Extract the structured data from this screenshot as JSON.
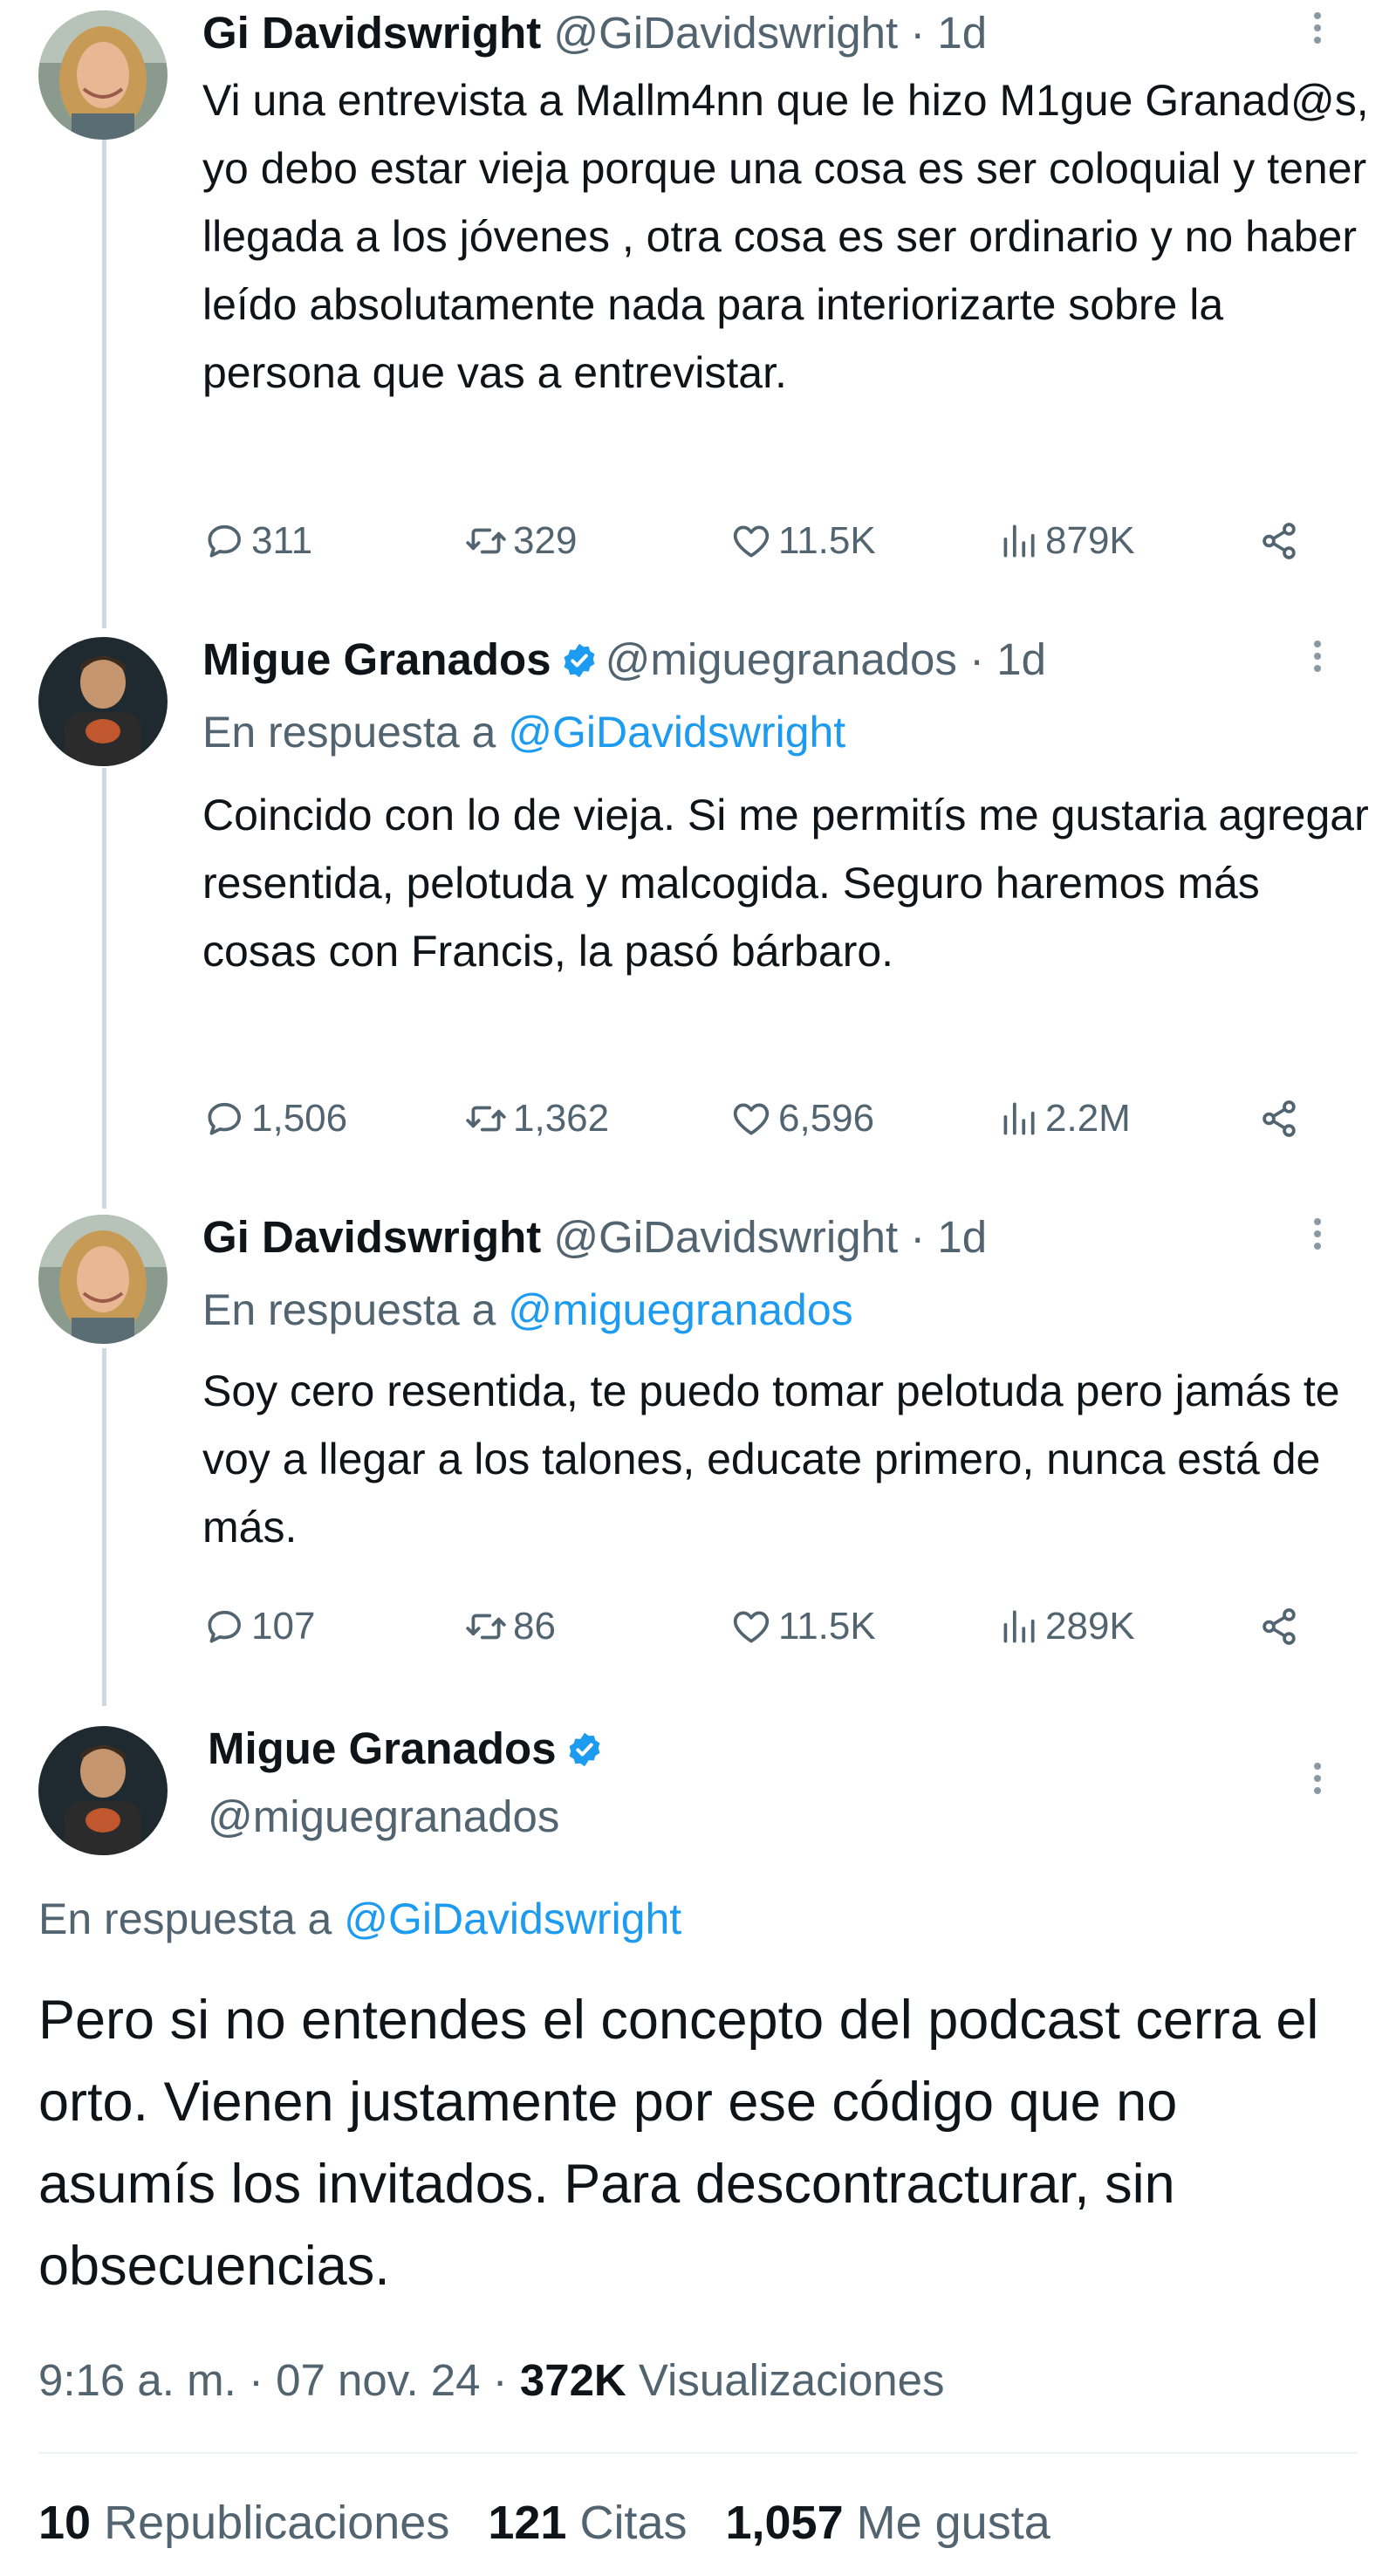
{
  "tweets": [
    {
      "name": "Gi Davidswright",
      "handle": "@GiDavidswright · 1d",
      "reply_prefix": "",
      "reply_handle": "",
      "text": "Vi una entrevista a Mallm4nn que le hizo M1gue Granad@s, yo debo estar vieja porque una cosa es ser coloquial y tener llegada a los jóvenes , otra cosa es ser ordinario y no haber leído absolutamente nada para interiorizarte sobre la persona que vas a entrevistar.",
      "replies": "311",
      "retweets": "329",
      "likes": "11.5K",
      "views": "879K",
      "avatar": "woman-avatar"
    },
    {
      "name": "Migue Granados",
      "handle": "@miguegranados · 1d",
      "reply_prefix": "En respuesta a ",
      "reply_handle": "@GiDavidswright",
      "text": "Coincido con lo de vieja. Si me permitís me gustaria agregar resentida, pelotuda y malcogida. Seguro haremos más cosas con Francis, la pasó bárbaro.",
      "replies": "1,506",
      "retweets": "1,362",
      "likes": "6,596",
      "views": "2.2M",
      "avatar": "man-avatar"
    },
    {
      "name": "Gi Davidswright",
      "handle": "@GiDavidswright · 1d",
      "reply_prefix": "En respuesta a ",
      "reply_handle": "@miguegranados",
      "text": "Soy cero resentida, te puedo tomar pelotuda pero jamás te voy a llegar a los talones, educate primero, nunca está de más.",
      "replies": "107",
      "retweets": "86",
      "likes": "11.5K",
      "views": "289K",
      "avatar": "woman-avatar"
    }
  ],
  "main_tweet": {
    "name": "Migue Granados",
    "handle": "@miguegranados",
    "reply_prefix": "En respuesta a ",
    "reply_handle": "@GiDavidswright",
    "text": "Pero si no entendes el concepto del podcast cerra el orto. Vienen justamente por ese código que no asumís los invitados. Para descontracturar, sin obsecuencias.",
    "time": "9:16 a. m. · 07 nov. 24 · ",
    "views_count": "372K",
    "views_label": " Visualizaciones",
    "reposts_count": "10",
    "reposts_label": " Republicaciones",
    "quotes_count": "121",
    "quotes_label": " Citas",
    "likes_count": "1,057",
    "likes_label": " Me gusta"
  },
  "icons": {
    "reply": "reply-icon",
    "retweet": "retweet-icon",
    "like": "heart-icon",
    "views": "views-icon",
    "share": "share-icon",
    "verified": "verified-badge-icon",
    "more": "more-icon"
  },
  "colors": {
    "text": "#0f1419",
    "secondary": "#536471",
    "link": "#1d9bf0",
    "verified": "#1d9bf0",
    "thread_line": "#cfd9de"
  }
}
